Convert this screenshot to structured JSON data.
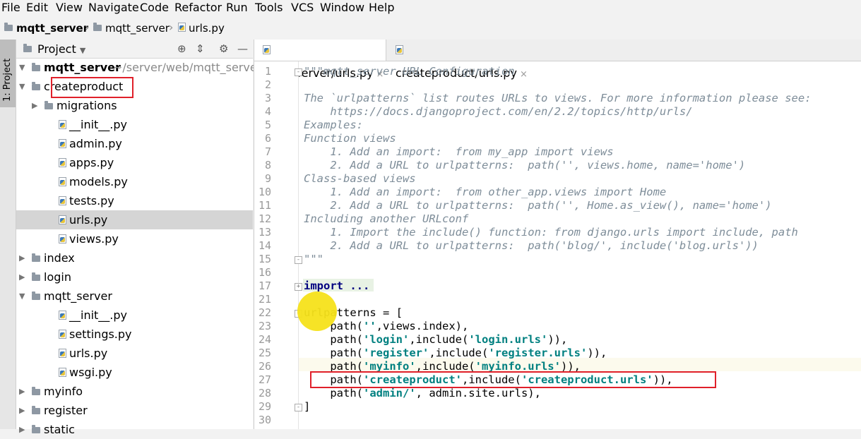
{
  "menu": [
    "File",
    "Edit",
    "View",
    "Navigate",
    "Code",
    "Refactor",
    "Run",
    "Tools",
    "VCS",
    "Window",
    "Help"
  ],
  "breadcrumb": [
    "mqtt_server",
    "mqtt_server",
    "urls.py"
  ],
  "sidebar_tab": "1: Project",
  "project_panel": {
    "title": "Project",
    "root_name": "mqtt_server",
    "root_path": "~/server/web/mqtt_server",
    "tree": [
      {
        "label": "createproduct",
        "type": "folder",
        "indent": 1,
        "expanded": true
      },
      {
        "label": "migrations",
        "type": "folder",
        "indent": 2,
        "expanded": false
      },
      {
        "label": "__init__.py",
        "type": "file",
        "indent": 2
      },
      {
        "label": "admin.py",
        "type": "file",
        "indent": 2
      },
      {
        "label": "apps.py",
        "type": "file",
        "indent": 2
      },
      {
        "label": "models.py",
        "type": "file",
        "indent": 2
      },
      {
        "label": "tests.py",
        "type": "file",
        "indent": 2
      },
      {
        "label": "urls.py",
        "type": "file",
        "indent": 2,
        "selected": true
      },
      {
        "label": "views.py",
        "type": "file",
        "indent": 2
      },
      {
        "label": "index",
        "type": "folder",
        "indent": 1,
        "expanded": false
      },
      {
        "label": "login",
        "type": "folder",
        "indent": 1,
        "expanded": false
      },
      {
        "label": "mqtt_server",
        "type": "folder",
        "indent": 1,
        "expanded": true
      },
      {
        "label": "__init__.py",
        "type": "file",
        "indent": 2
      },
      {
        "label": "settings.py",
        "type": "file",
        "indent": 2
      },
      {
        "label": "urls.py",
        "type": "file",
        "indent": 2
      },
      {
        "label": "wsgi.py",
        "type": "file",
        "indent": 2
      },
      {
        "label": "myinfo",
        "type": "folder",
        "indent": 1,
        "expanded": false
      },
      {
        "label": "register",
        "type": "folder",
        "indent": 1,
        "expanded": false
      },
      {
        "label": "static",
        "type": "folder",
        "indent": 1,
        "expanded": false
      }
    ]
  },
  "tabs": [
    {
      "label": "mqtt_server/urls.py",
      "active": true
    },
    {
      "label": "createproduct/urls.py",
      "active": false
    }
  ],
  "tab_close": "×",
  "code": [
    {
      "n": "1",
      "text": "\"\"\"mqtt_server URL Configuration",
      "style": "doc"
    },
    {
      "n": "2",
      "text": "",
      "style": "doc"
    },
    {
      "n": "3",
      "text": "The `urlpatterns` list routes URLs to views. For more information please see:",
      "style": "doc"
    },
    {
      "n": "4",
      "text": "    https://docs.djangoproject.com/en/2.2/topics/http/urls/",
      "style": "doc"
    },
    {
      "n": "5",
      "text": "Examples:",
      "style": "doc"
    },
    {
      "n": "6",
      "text": "Function views",
      "style": "doc"
    },
    {
      "n": "7",
      "text": "    1. Add an import:  from my_app import views",
      "style": "doc"
    },
    {
      "n": "8",
      "text": "    2. Add a URL to urlpatterns:  path('', views.home, name='home')",
      "style": "doc"
    },
    {
      "n": "9",
      "text": "Class-based views",
      "style": "doc"
    },
    {
      "n": "10",
      "text": "    1. Add an import:  from other_app.views import Home",
      "style": "doc"
    },
    {
      "n": "11",
      "text": "    2. Add a URL to urlpatterns:  path('', Home.as_view(), name='home')",
      "style": "doc"
    },
    {
      "n": "12",
      "text": "Including another URLconf",
      "style": "doc"
    },
    {
      "n": "13",
      "text": "    1. Import the include() function: from django.urls import include, path",
      "style": "doc"
    },
    {
      "n": "14",
      "text": "    2. Add a URL to urlpatterns:  path('blog/', include('blog.urls'))",
      "style": "doc"
    },
    {
      "n": "15",
      "text": "\"\"\"",
      "style": "doc"
    },
    {
      "n": "16",
      "text": "",
      "style": "plain"
    },
    {
      "n": "17",
      "text": "import ...",
      "style": "kw"
    },
    {
      "n": "21",
      "text": "",
      "style": "plain"
    },
    {
      "n": "22",
      "parts": [
        [
          "urlpatterns = [",
          "plain"
        ]
      ]
    },
    {
      "n": "23",
      "parts": [
        [
          "    path(",
          "plain"
        ],
        [
          "''",
          "str"
        ],
        [
          ",views.index),",
          "plain"
        ]
      ]
    },
    {
      "n": "24",
      "parts": [
        [
          "    path(",
          "plain"
        ],
        [
          "'login'",
          "str"
        ],
        [
          ",include(",
          "plain"
        ],
        [
          "'login.urls'",
          "str"
        ],
        [
          ")),",
          "plain"
        ]
      ]
    },
    {
      "n": "25",
      "parts": [
        [
          "    path(",
          "plain"
        ],
        [
          "'register'",
          "str"
        ],
        [
          ",include(",
          "plain"
        ],
        [
          "'register.urls'",
          "str"
        ],
        [
          ")),",
          "plain"
        ]
      ]
    },
    {
      "n": "26",
      "parts": [
        [
          "    path(",
          "plain"
        ],
        [
          "'myinfo'",
          "str"
        ],
        [
          ",include(",
          "plain"
        ],
        [
          "'myinfo.urls'",
          "str"
        ],
        [
          ")),",
          "plain"
        ]
      ]
    },
    {
      "n": "27",
      "parts": [
        [
          "    path(",
          "plain"
        ],
        [
          "'createproduct'",
          "str"
        ],
        [
          ",include(",
          "plain"
        ],
        [
          "'createproduct.urls'",
          "str"
        ],
        [
          ")),",
          "plain"
        ]
      ]
    },
    {
      "n": "28",
      "parts": [
        [
          "    path(",
          "plain"
        ],
        [
          "'admin/'",
          "str"
        ],
        [
          ", admin.site.urls),",
          "plain"
        ]
      ]
    },
    {
      "n": "29",
      "parts": [
        [
          "]",
          "plain"
        ]
      ]
    },
    {
      "n": "30",
      "text": "",
      "style": "plain"
    }
  ],
  "colors": {
    "highlight_box": "#e0202a",
    "cursor_marker": "#f5e11a",
    "docstring": "#7e8d99",
    "string": "#008080",
    "keyword": "#000080"
  }
}
